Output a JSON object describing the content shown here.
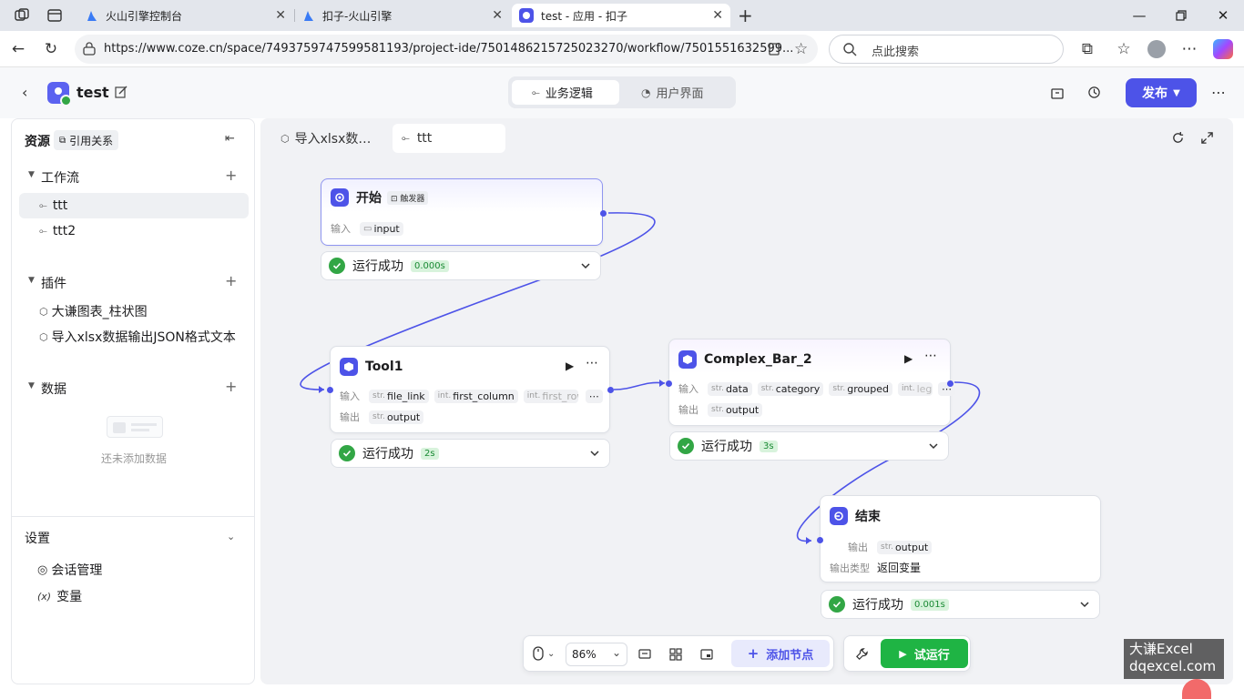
{
  "browser": {
    "tabs": [
      {
        "label": "火山引擎控制台"
      },
      {
        "label": "扣子-火山引擎"
      },
      {
        "label": "test - 应用 - 扣子"
      }
    ],
    "url": "https://www.coze.cn/space/7493759747599581193/project-ide/7501486215725023270/workflow/7501551632599...",
    "search_placeholder": "点此搜索"
  },
  "app": {
    "project_name": "test",
    "tabs": [
      {
        "label": "业务逻辑"
      },
      {
        "label": "用户界面"
      }
    ],
    "publish_label": "发布"
  },
  "sidebar": {
    "resources_label": "资源",
    "references_label": "引用关系",
    "workflows": {
      "title": "工作流",
      "items": [
        {
          "label": "ttt"
        },
        {
          "label": "ttt2"
        }
      ]
    },
    "plugins": {
      "title": "插件",
      "items": [
        {
          "label": "大谦图表_柱状图"
        },
        {
          "label": "导入xlsx数据输出JSON格式文本"
        }
      ]
    },
    "data": {
      "title": "数据",
      "empty_text": "还未添加数据"
    },
    "settings": {
      "title": "设置",
      "items": [
        {
          "label": "会话管理",
          "icon": "(x)"
        },
        {
          "label": "变量",
          "icon": "(x)"
        }
      ]
    }
  },
  "canvas": {
    "tabs": [
      {
        "label": "导入xlsx数…"
      },
      {
        "label": "ttt"
      }
    ],
    "nodes": {
      "start": {
        "title": "开始",
        "badge": "触发器",
        "input_label": "输入",
        "input_param": "input",
        "status": "运行成功",
        "time": "0.000s"
      },
      "tool1": {
        "title": "Tool1",
        "input_label": "输入",
        "output_label": "输出",
        "inputs": [
          {
            "type": "str.",
            "name": "file_link"
          },
          {
            "type": "int.",
            "name": "first_column"
          },
          {
            "type": "int.",
            "name": "first_row"
          }
        ],
        "outputs": [
          {
            "type": "str.",
            "name": "output"
          }
        ],
        "status": "运行成功",
        "time": "2s"
      },
      "bar": {
        "title": "Complex_Bar_2",
        "input_label": "输入",
        "output_label": "输出",
        "inputs": [
          {
            "type": "str.",
            "name": "data"
          },
          {
            "type": "str.",
            "name": "category"
          },
          {
            "type": "str.",
            "name": "grouped"
          },
          {
            "type": "int.",
            "name": "lege"
          }
        ],
        "outputs": [
          {
            "type": "str.",
            "name": "output"
          }
        ],
        "status": "运行成功",
        "time": "3s"
      },
      "end": {
        "title": "结束",
        "output_label": "输出",
        "output_param": {
          "type": "str.",
          "name": "output"
        },
        "output_type_label": "输出类型",
        "output_type_value": "返回变量",
        "status": "运行成功",
        "time": "0.001s"
      }
    }
  },
  "toolbar": {
    "zoom": "86%",
    "add_node_label": "添加节点",
    "run_label": "试运行"
  },
  "watermark": {
    "line1": "大谦Excel",
    "line2": "dqexcel.com"
  },
  "colors": {
    "accent": "#4d53e8",
    "success": "#32a645",
    "run": "#1fb444"
  }
}
